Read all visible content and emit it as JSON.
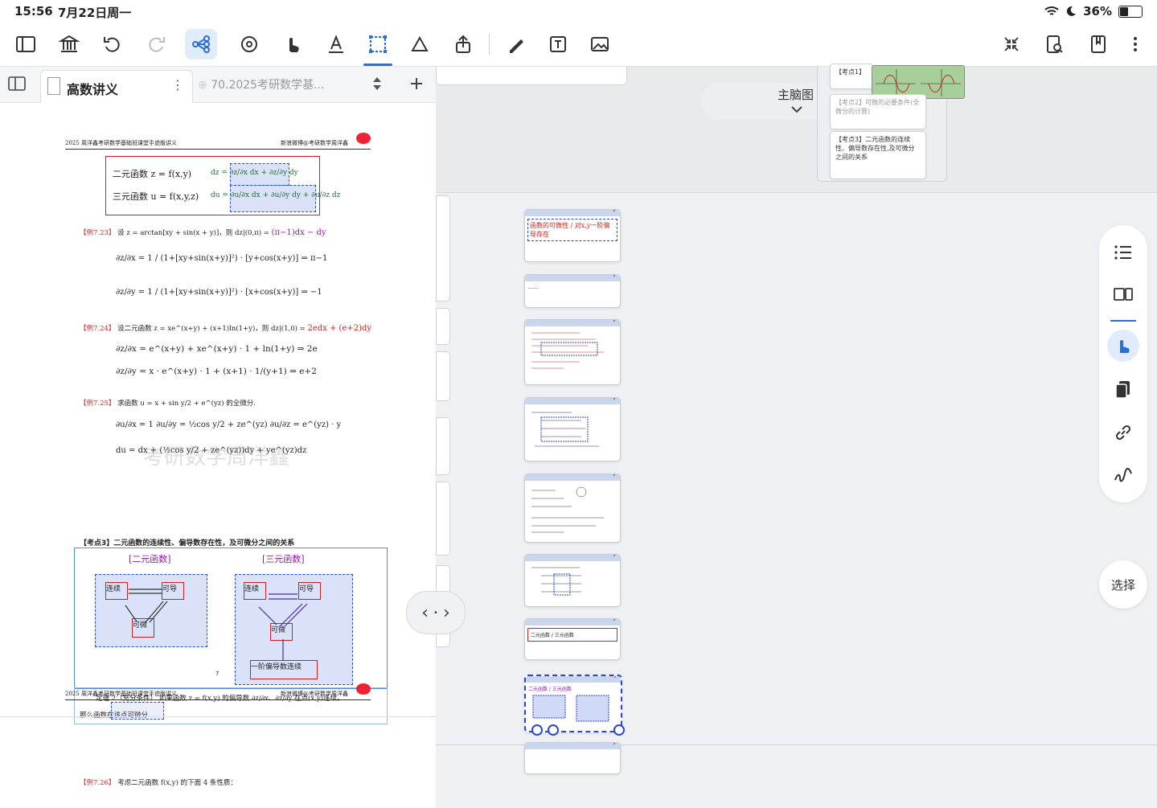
{
  "status_bar": {
    "time": "15:56",
    "date": "7月22日周一",
    "battery": "36%"
  },
  "doc_tabs": {
    "active_tab": "高数讲义",
    "other_tab": "70.2025考研数学基..."
  },
  "page": {
    "header_left": "2025 周洋鑫考研数学基础班课堂手迹版讲义",
    "header_right": "新浪微博@考研数学周洋鑫",
    "box_line1": "二元函数 z = f(x,y)",
    "box_line2": "三元函数 u = f(x,y,z)",
    "box_dz": "dz = ∂z/∂x dx + ∂z/∂y dy",
    "box_du": "du = ∂u/∂x dx + ∂u/∂y dy + ∂u/∂z dz",
    "ex723": "【例7.23】",
    "ex723_text": "设 z = arctan[xy + sin(x + y)]，则 dz|(0,π) =",
    "ex723_ans": "(π−1)dx − dy",
    "ex723_l1": "∂z/∂x = 1 / (1+[xy+sin(x+y)]²) · [y+cos(x+y)] ⇒ π−1",
    "ex723_l2": "∂z/∂y = 1 / (1+[xy+sin(x+y)]²) · [x+cos(x+y)] ⇒ −1",
    "ex724": "【例7.24】",
    "ex724_text": "设二元函数 z = xe^(x+y) + (x+1)ln(1+y)，则 dz|(1,0) =",
    "ex724_ans": "2edx + (e+2)dy",
    "ex724_l1": "∂z/∂x = e^(x+y) + xe^(x+y) · 1 + ln(1+y) ⇒ 2e",
    "ex724_l2": "∂z/∂y = x · e^(x+y) · 1 + (x+1) · 1/(y+1) ⇒ e+2",
    "ex725": "【例7.25】",
    "ex725_text": "求函数 u = x + sin y/2 + e^(yz) 的全微分.",
    "ex725_l1": "∂u/∂x = 1   ∂u/∂y = ½cos y/2 + ze^(yz)   ∂u/∂z = e^(yz) · y",
    "ex725_l2": "du = dx + (½cos y/2 + ze^(yz))dy + ye^(yz)dz",
    "kaodian3": "【考点3】二元函数的连续性、偏导数存在性，及可微分之间的关系",
    "diag_left_title": "[二元函数]",
    "diag_right_title": "[三元函数]",
    "lian_xu": "连续",
    "ke_dao": "可导",
    "ke_wei": "可微",
    "pian_dao": "一阶偏导数连续",
    "theorem": "定理 2（充分条件）  如果函数 z = f(x,y) 的偏导数 ∂z/∂x、∂z/∂y 在点(x,y)连续，",
    "theorem2": "那么函数在该点可微分.",
    "page_number": "7",
    "watermark": "考研数学周洋鑫",
    "ex726": "【例7.26】",
    "ex726_text": "考虑二元函数 f(x,y) 的下面 4 条性质："
  },
  "mindmap": {
    "title": "主脑图",
    "card_kd1": "【考点1】",
    "card_kd2": "【考点2】可微的必要条件(全微分的计算)",
    "card_kd3": "【考点3】二元函数的连续性、偏导数存在性,及可微分之间的关系",
    "thumb1_text": "函数的可微性 / 对x,y一阶偏导存在",
    "thumb2_text": "……",
    "thumb7_text": "二元函数 / 三元函数",
    "thumb8_text": "二元函数 / 三元函数"
  },
  "right_panel": {
    "select_label": "选择"
  },
  "colors": {
    "accent": "#2a6ed8",
    "red_ink": "#c22",
    "purple_ink": "#8a1c9a",
    "blue_box": "#2a4fd8"
  }
}
